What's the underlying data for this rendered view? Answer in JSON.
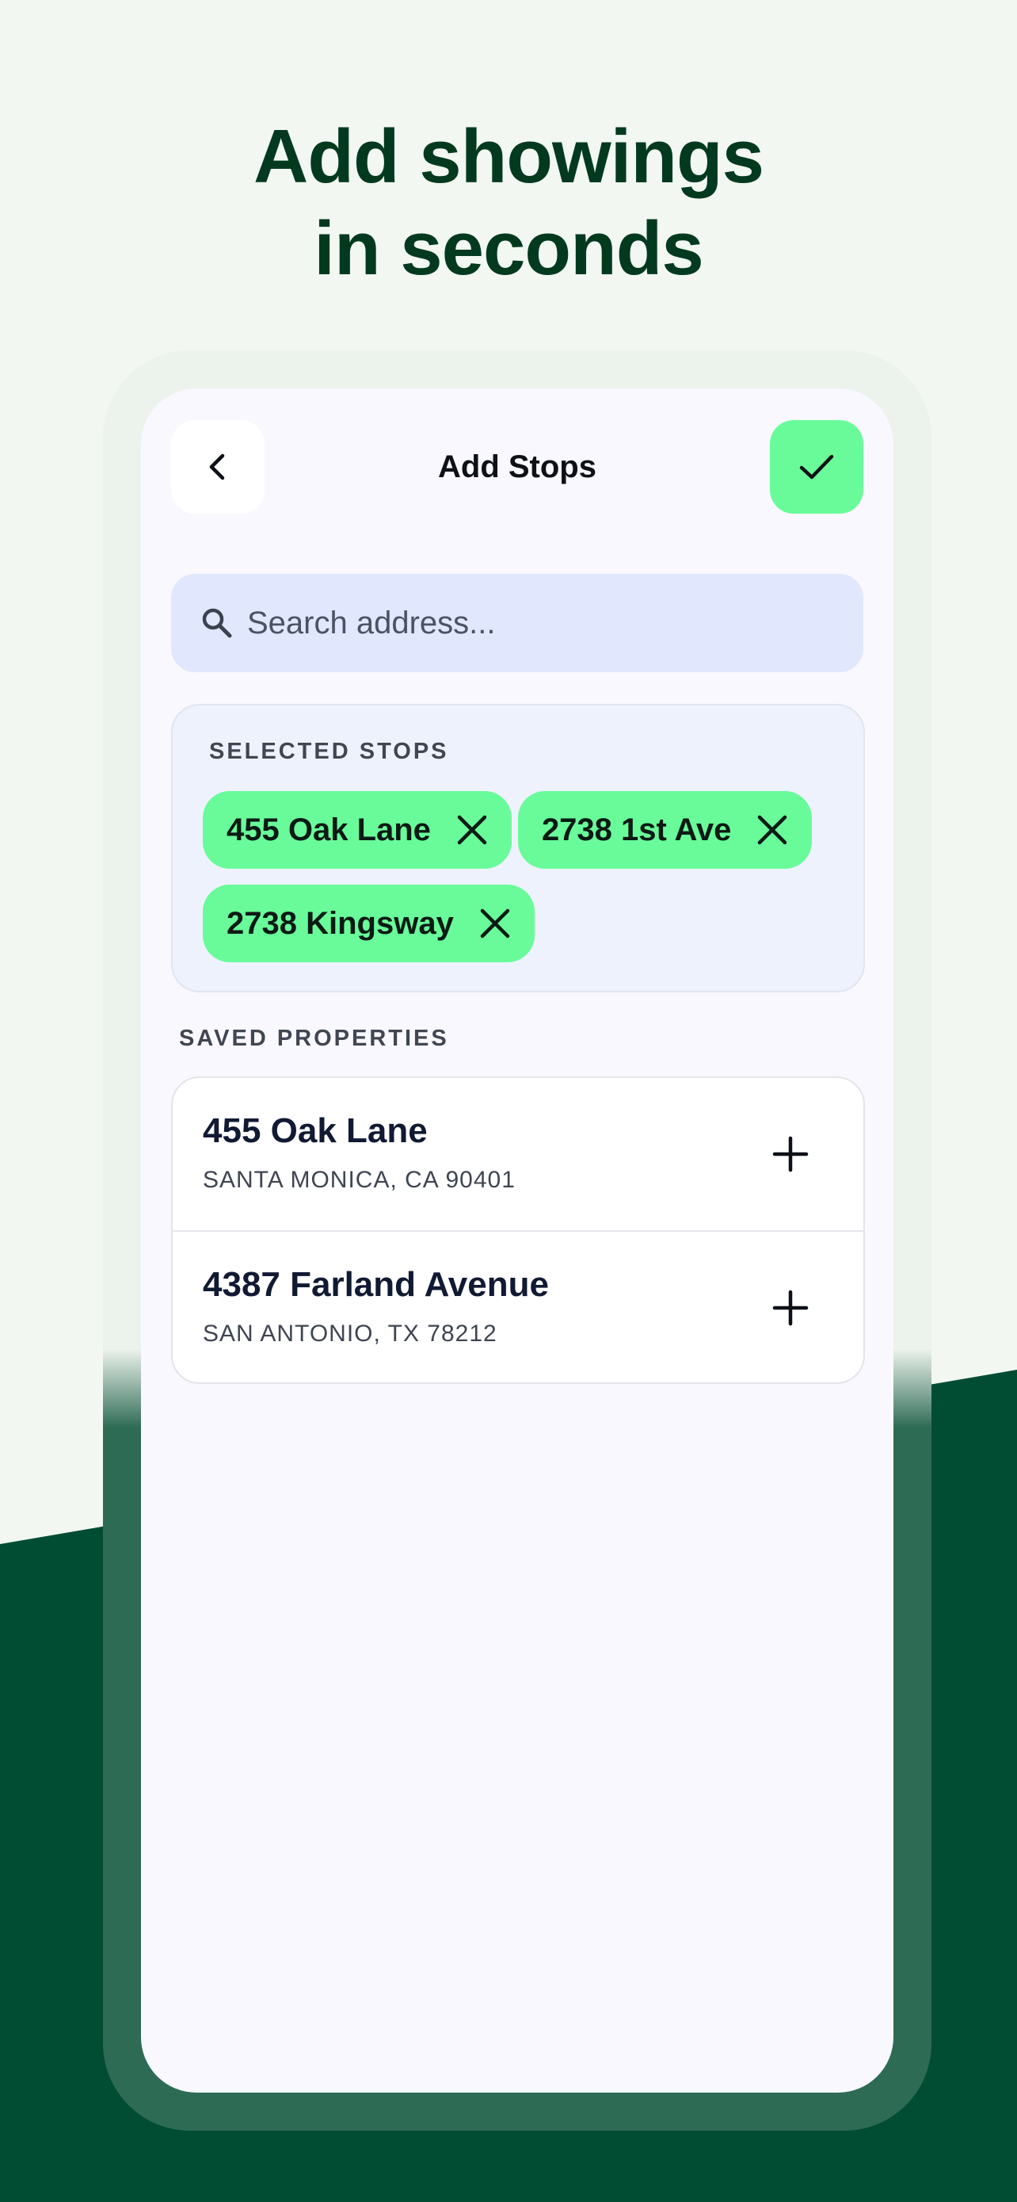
{
  "headline": {
    "line1": "Add showings",
    "line2": "in seconds"
  },
  "header": {
    "title": "Add Stops",
    "back_icon": "chevron-left-icon",
    "confirm_icon": "check-icon"
  },
  "search": {
    "placeholder": "Search address...",
    "value": "",
    "icon": "search-icon"
  },
  "selected_stops": {
    "label": "SELECTED STOPS",
    "items": [
      {
        "label": "455 Oak Lane"
      },
      {
        "label": "2738 1st Ave"
      },
      {
        "label": "2738 Kingsway"
      }
    ]
  },
  "saved_properties": {
    "label": "SAVED PROPERTIES",
    "items": [
      {
        "name": "455 Oak Lane",
        "address": "SANTA MONICA, CA 90401"
      },
      {
        "name": "4387 Farland Avenue",
        "address": "SAN ANTONIO, TX 78212"
      }
    ]
  },
  "colors": {
    "accent": "#69fb9a",
    "brand_dark": "#004d33",
    "headline": "#033a1f",
    "search_bg": "#e1e7fc"
  }
}
